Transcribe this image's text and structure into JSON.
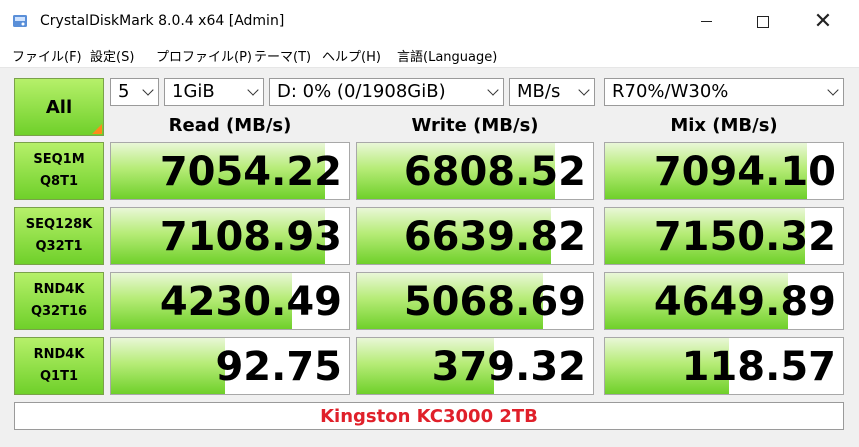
{
  "window": {
    "title": "CrystalDiskMark 8.0.4 x64 [Admin]",
    "controls": {
      "minimize": "minimize",
      "maximize": "maximize",
      "close": "✕"
    }
  },
  "menu": [
    "ファイル(F)",
    "設定(S)",
    "プロファイル(P)",
    "テーマ(T)",
    "ヘルプ(H)",
    "言語(Language)"
  ],
  "controls": {
    "all_label": "All",
    "count": "5",
    "size": "1GiB",
    "drive": "D: 0% (0/1908GiB)",
    "unit": "MB/s",
    "mix": "R70%/W30%"
  },
  "columns": [
    "Read (MB/s)",
    "Write (MB/s)",
    "Mix (MB/s)"
  ],
  "rows": [
    {
      "line1": "SEQ1M",
      "line2": "Q8T1",
      "read": "7054.22",
      "write": "6808.52",
      "mix": "7094.10"
    },
    {
      "line1": "SEQ128K",
      "line2": "Q32T1",
      "read": "7108.93",
      "write": "6639.82",
      "mix": "7150.32"
    },
    {
      "line1": "RND4K",
      "line2": "Q32T16",
      "read": "4230.49",
      "write": "5068.69",
      "mix": "4649.89"
    },
    {
      "line1": "RND4K",
      "line2": "Q1T1",
      "read": "92.75",
      "write": "379.32",
      "mix": "118.57"
    }
  ],
  "fill_levels": [
    {
      "read": 0.9,
      "write": 0.84,
      "mix": 0.85
    },
    {
      "read": 0.9,
      "write": 0.82,
      "mix": 0.84
    },
    {
      "read": 0.76,
      "write": 0.79,
      "mix": 0.77
    },
    {
      "read": 0.48,
      "write": 0.58,
      "mix": 0.52
    }
  ],
  "footer": {
    "comment": "Kingston KC3000 2TB"
  },
  "colors": {
    "accent_green": "#6fd02a",
    "corner_orange": "#ff8a1a",
    "comment_red": "#e0202a"
  }
}
